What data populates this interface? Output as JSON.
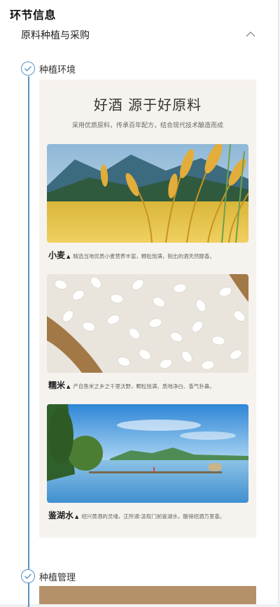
{
  "header": {
    "title": "环节信息"
  },
  "subsection": {
    "label": "原料种植与采购",
    "expanded": true
  },
  "steps": [
    {
      "label": "种植环境",
      "status": "done"
    },
    {
      "label": "种植管理",
      "status": "done"
    }
  ],
  "poster": {
    "title": "好酒 源于好原料",
    "subtitle": "采用优质原料，传承百年配方，结合现代技术酿造而成",
    "items": [
      {
        "name": "小麦",
        "desc": "精选当地优质小麦营养丰富，颗粒饱满，制出的酒天然醇香。"
      },
      {
        "name": "糯米",
        "desc": "产自鱼米之乡之千里沃野，颗粒饱满、质地净白、香气扑鼻。"
      },
      {
        "name": "鉴湖水",
        "desc": "绍兴黄酒的灵魂，正所谓:汲取门前鉴湖水，酿得绍酒万里香。"
      }
    ]
  },
  "colors": {
    "accent": "#5a93c4",
    "poster_bg": "#f6f2ee",
    "bottom_band": "#b5916a"
  },
  "icons": {
    "collapse": "chevron-up-icon",
    "step": "check-circle-icon"
  }
}
